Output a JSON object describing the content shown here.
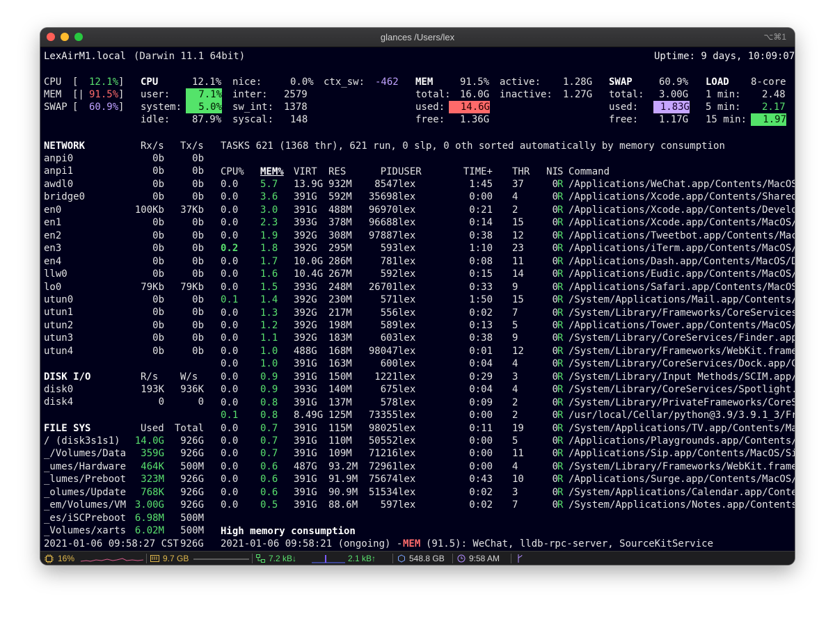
{
  "window": {
    "title": "glances /Users/lex",
    "shortcut": "⌥⌘1"
  },
  "colors": {
    "green": "#59e06e",
    "red": "#ff6b6b",
    "purple": "#bfa2ff",
    "background": "#00001a"
  },
  "header": {
    "host": "LexAirM1.local",
    "os": "(Darwin 11.1 64bit)",
    "uptime": "Uptime: 9 days, 10:09:07"
  },
  "quicklook": {
    "cpu_label": "CPU",
    "cpu_val": "12.1%",
    "mem_label": "MEM",
    "mem_val": "91.5%",
    "swap_label": "SWAP",
    "swap_val": "60.9%"
  },
  "cpu": {
    "title": "CPU",
    "total": "12.1%",
    "user_label": "user:",
    "user": "7.1%",
    "system_label": "system:",
    "system": "5.0%",
    "idle_label": "idle:",
    "idle": "87.9%",
    "nice_label": "nice:",
    "nice": "0.0%",
    "ctx_label": "ctx_sw:",
    "ctx": "-462",
    "inter_label": "inter:",
    "inter": "2579",
    "swint_label": "sw_int:",
    "swint": "1378",
    "syscal_label": "syscal:",
    "syscal": "148"
  },
  "mem": {
    "title": "MEM",
    "pct": "91.5%",
    "total_label": "total:",
    "total": "16.0G",
    "used_label": "used:",
    "used": "14.6G",
    "free_label": "free:",
    "free": "1.36G",
    "active_label": "active:",
    "active": "1.28G",
    "inactive_label": "inactive:",
    "inactive": "1.27G"
  },
  "swap": {
    "title": "SWAP",
    "pct": "60.9%",
    "total_label": "total:",
    "total": "3.00G",
    "used_label": "used:",
    "used": "1.83G",
    "free_label": "free:",
    "free": "1.17G"
  },
  "load": {
    "title": "LOAD",
    "cores": "8-core",
    "m1_label": "1 min:",
    "m1": "2.48",
    "m5_label": "5 min:",
    "m5": "2.17",
    "m15_label": "15 min:",
    "m15": "1.97"
  },
  "network": {
    "title": "NETWORK",
    "rx": "Rx/s",
    "tx": "Tx/s",
    "rows": [
      {
        "name": "anpi0",
        "rx": "0b",
        "tx": "0b"
      },
      {
        "name": "anpi1",
        "rx": "0b",
        "tx": "0b"
      },
      {
        "name": "awdl0",
        "rx": "0b",
        "tx": "0b"
      },
      {
        "name": "bridge0",
        "rx": "0b",
        "tx": "0b"
      },
      {
        "name": "en0",
        "rx": "100Kb",
        "tx": "37Kb"
      },
      {
        "name": "en1",
        "rx": "0b",
        "tx": "0b"
      },
      {
        "name": "en2",
        "rx": "0b",
        "tx": "0b"
      },
      {
        "name": "en3",
        "rx": "0b",
        "tx": "0b"
      },
      {
        "name": "en4",
        "rx": "0b",
        "tx": "0b"
      },
      {
        "name": "llw0",
        "rx": "0b",
        "tx": "0b"
      },
      {
        "name": "lo0",
        "rx": "79Kb",
        "tx": "79Kb"
      },
      {
        "name": "utun0",
        "rx": "0b",
        "tx": "0b"
      },
      {
        "name": "utun1",
        "rx": "0b",
        "tx": "0b"
      },
      {
        "name": "utun2",
        "rx": "0b",
        "tx": "0b"
      },
      {
        "name": "utun3",
        "rx": "0b",
        "tx": "0b"
      },
      {
        "name": "utun4",
        "rx": "0b",
        "tx": "0b"
      }
    ]
  },
  "disk": {
    "title": "DISK I/O",
    "r": "R/s",
    "w": "W/s",
    "rows": [
      {
        "name": "disk0",
        "r": "193K",
        "w": "936K"
      },
      {
        "name": "disk4",
        "r": "0",
        "w": "0"
      }
    ]
  },
  "fs": {
    "title": "FILE SYS",
    "used": "Used",
    "total": "Total",
    "rows": [
      {
        "name": "/ (disk3s1s1)",
        "used": "14.0G",
        "total": "926G"
      },
      {
        "name": "_/Volumes/Data",
        "used": "359G",
        "total": "926G"
      },
      {
        "name": "_umes/Hardware",
        "used": "464K",
        "total": "500M"
      },
      {
        "name": "_lumes/Preboot",
        "used": "323M",
        "total": "926G"
      },
      {
        "name": "_olumes/Update",
        "used": "768K",
        "total": "926G"
      },
      {
        "name": "_em/Volumes/VM",
        "used": "3.00G",
        "total": "926G"
      },
      {
        "name": "_es/iSCPreboot",
        "used": "6.98M",
        "total": "500M"
      },
      {
        "name": "_Volumes/xarts",
        "used": "6.02M",
        "total": "500M"
      }
    ],
    "timestamp": "2021-01-06 09:58:27 CST",
    "last_total": "926G"
  },
  "tasks": {
    "summary": "TASKS 621 (1368 thr), 621 run, 0 slp, 0 oth sorted automatically by memory consumption"
  },
  "proc_headers": {
    "cpu": "CPU%",
    "mem": "MEM%",
    "virt": "VIRT",
    "res": "RES",
    "pid": "PID",
    "user": "USER",
    "time": "TIME+",
    "thr": "THR",
    "ni": "NI",
    "s": "S",
    "cmd": "Command"
  },
  "processes": [
    {
      "cpu": "0.0",
      "mem": "5.7",
      "virt": "13.9G",
      "res": "932M",
      "pid": "8547",
      "user": "lex",
      "time": "1:45",
      "thr": "37",
      "ni": "0",
      "s": "R",
      "cmd": "/Applications/WeChat.app/Contents/MacOS"
    },
    {
      "cpu": "0.0",
      "mem": "3.6",
      "virt": "391G",
      "res": "592M",
      "pid": "35698",
      "user": "lex",
      "time": "0:00",
      "thr": "4",
      "ni": "0",
      "s": "R",
      "cmd": "/Applications/Xcode.app/Contents/Shared"
    },
    {
      "cpu": "0.0",
      "mem": "3.0",
      "virt": "391G",
      "res": "488M",
      "pid": "96970",
      "user": "lex",
      "time": "0:21",
      "thr": "2",
      "ni": "0",
      "s": "R",
      "cmd": "/Applications/Xcode.app/Contents/Develo"
    },
    {
      "cpu": "0.0",
      "mem": "2.3",
      "virt": "393G",
      "res": "378M",
      "pid": "96688",
      "user": "lex",
      "time": "0:14",
      "thr": "15",
      "ni": "0",
      "s": "R",
      "cmd": "/Applications/Xcode.app/Contents/MacOS/"
    },
    {
      "cpu": "0.0",
      "mem": "1.9",
      "virt": "392G",
      "res": "308M",
      "pid": "97887",
      "user": "lex",
      "time": "0:38",
      "thr": "12",
      "ni": "0",
      "s": "R",
      "cmd": "/Applications/Tweetbot.app/Contents/Mac"
    },
    {
      "cpu": "0.2",
      "mem": "1.8",
      "virt": "392G",
      "res": "295M",
      "pid": "593",
      "user": "lex",
      "time": "1:10",
      "thr": "23",
      "ni": "0",
      "s": "R",
      "cmd": "/Applications/iTerm.app/Contents/MacOS/"
    },
    {
      "cpu": "0.0",
      "mem": "1.7",
      "virt": "10.0G",
      "res": "286M",
      "pid": "781",
      "user": "lex",
      "time": "0:08",
      "thr": "11",
      "ni": "0",
      "s": "R",
      "cmd": "/Applications/Dash.app/Contents/MacOS/D"
    },
    {
      "cpu": "0.0",
      "mem": "1.6",
      "virt": "10.4G",
      "res": "267M",
      "pid": "592",
      "user": "lex",
      "time": "0:15",
      "thr": "14",
      "ni": "0",
      "s": "R",
      "cmd": "/Applications/Eudic.app/Contents/MacOS/"
    },
    {
      "cpu": "0.0",
      "mem": "1.5",
      "virt": "393G",
      "res": "248M",
      "pid": "26701",
      "user": "lex",
      "time": "0:33",
      "thr": "9",
      "ni": "0",
      "s": "R",
      "cmd": "/Applications/Safari.app/Contents/MacOS"
    },
    {
      "cpu": "0.1",
      "mem": "1.4",
      "virt": "392G",
      "res": "230M",
      "pid": "571",
      "user": "lex",
      "time": "1:50",
      "thr": "15",
      "ni": "0",
      "s": "R",
      "cmd": "/System/Applications/Mail.app/Contents/"
    },
    {
      "cpu": "0.0",
      "mem": "1.3",
      "virt": "392G",
      "res": "217M",
      "pid": "556",
      "user": "lex",
      "time": "0:02",
      "thr": "7",
      "ni": "0",
      "s": "R",
      "cmd": "/System/Library/Frameworks/CoreServices"
    },
    {
      "cpu": "0.0",
      "mem": "1.2",
      "virt": "392G",
      "res": "198M",
      "pid": "589",
      "user": "lex",
      "time": "0:13",
      "thr": "5",
      "ni": "0",
      "s": "R",
      "cmd": "/Applications/Tower.app/Contents/MacOS/"
    },
    {
      "cpu": "0.0",
      "mem": "1.1",
      "virt": "392G",
      "res": "183M",
      "pid": "603",
      "user": "lex",
      "time": "0:38",
      "thr": "9",
      "ni": "0",
      "s": "R",
      "cmd": "/System/Library/CoreServices/Finder.app"
    },
    {
      "cpu": "0.0",
      "mem": "1.0",
      "virt": "488G",
      "res": "168M",
      "pid": "98047",
      "user": "lex",
      "time": "0:01",
      "thr": "12",
      "ni": "0",
      "s": "R",
      "cmd": "/System/Library/Frameworks/WebKit.frame"
    },
    {
      "cpu": "0.0",
      "mem": "1.0",
      "virt": "391G",
      "res": "163M",
      "pid": "600",
      "user": "lex",
      "time": "0:04",
      "thr": "4",
      "ni": "0",
      "s": "R",
      "cmd": "/System/Library/CoreServices/Dock.app/C"
    },
    {
      "cpu": "0.0",
      "mem": "0.9",
      "virt": "391G",
      "res": "150M",
      "pid": "1221",
      "user": "lex",
      "time": "0:29",
      "thr": "3",
      "ni": "0",
      "s": "R",
      "cmd": "/System/Library/Input Methods/SCIM.app/"
    },
    {
      "cpu": "0.0",
      "mem": "0.9",
      "virt": "393G",
      "res": "140M",
      "pid": "675",
      "user": "lex",
      "time": "0:04",
      "thr": "4",
      "ni": "0",
      "s": "R",
      "cmd": "/System/Library/CoreServices/Spotlight."
    },
    {
      "cpu": "0.0",
      "mem": "0.8",
      "virt": "391G",
      "res": "137M",
      "pid": "578",
      "user": "lex",
      "time": "0:09",
      "thr": "2",
      "ni": "0",
      "s": "R",
      "cmd": "/System/Library/PrivateFrameworks/CoreS"
    },
    {
      "cpu": "0.1",
      "mem": "0.8",
      "virt": "8.49G",
      "res": "125M",
      "pid": "73355",
      "user": "lex",
      "time": "0:00",
      "thr": "2",
      "ni": "0",
      "s": "R",
      "cmd": "/usr/local/Cellar/python@3.9/3.9.1_3/Fr"
    },
    {
      "cpu": "0.0",
      "mem": "0.7",
      "virt": "391G",
      "res": "115M",
      "pid": "98025",
      "user": "lex",
      "time": "0:11",
      "thr": "19",
      "ni": "0",
      "s": "R",
      "cmd": "/System/Applications/TV.app/Contents/Ma"
    },
    {
      "cpu": "0.0",
      "mem": "0.7",
      "virt": "391G",
      "res": "110M",
      "pid": "50552",
      "user": "lex",
      "time": "0:00",
      "thr": "5",
      "ni": "0",
      "s": "R",
      "cmd": "/Applications/Playgrounds.app/Contents/"
    },
    {
      "cpu": "0.0",
      "mem": "0.7",
      "virt": "391G",
      "res": "109M",
      "pid": "71216",
      "user": "lex",
      "time": "0:00",
      "thr": "11",
      "ni": "0",
      "s": "R",
      "cmd": "/Applications/Sip.app/Contents/MacOS/Si"
    },
    {
      "cpu": "0.0",
      "mem": "0.6",
      "virt": "487G",
      "res": "93.2M",
      "pid": "72961",
      "user": "lex",
      "time": "0:00",
      "thr": "4",
      "ni": "0",
      "s": "R",
      "cmd": "/System/Library/Frameworks/WebKit.frame"
    },
    {
      "cpu": "0.0",
      "mem": "0.6",
      "virt": "391G",
      "res": "91.9M",
      "pid": "75674",
      "user": "lex",
      "time": "0:43",
      "thr": "10",
      "ni": "0",
      "s": "R",
      "cmd": "/Applications/Surge.app/Contents/MacOS/"
    },
    {
      "cpu": "0.0",
      "mem": "0.6",
      "virt": "391G",
      "res": "90.9M",
      "pid": "51534",
      "user": "lex",
      "time": "0:02",
      "thr": "3",
      "ni": "0",
      "s": "R",
      "cmd": "/System/Applications/Calendar.app/Conte"
    },
    {
      "cpu": "0.0",
      "mem": "0.5",
      "virt": "391G",
      "res": "88.6M",
      "pid": "597",
      "user": "lex",
      "time": "0:02",
      "thr": "7",
      "ni": "0",
      "s": "R",
      "cmd": "/System/Applications/Notes.app/Contents"
    }
  ],
  "alert": {
    "title": "High memory consumption",
    "time": "2021-01-06 09:58:21 (ongoing) -",
    "tag": "MEM",
    "text": "(91.5): WeChat, lldb-rpc-server, SourceKitService"
  },
  "statusbar": {
    "cpu": "16%",
    "mem": "9.7 GB",
    "net_down": "7.2 kB↓",
    "net_up": "2.1 kB↑",
    "disk": "548.8 GB",
    "clock": "9:58 AM"
  }
}
